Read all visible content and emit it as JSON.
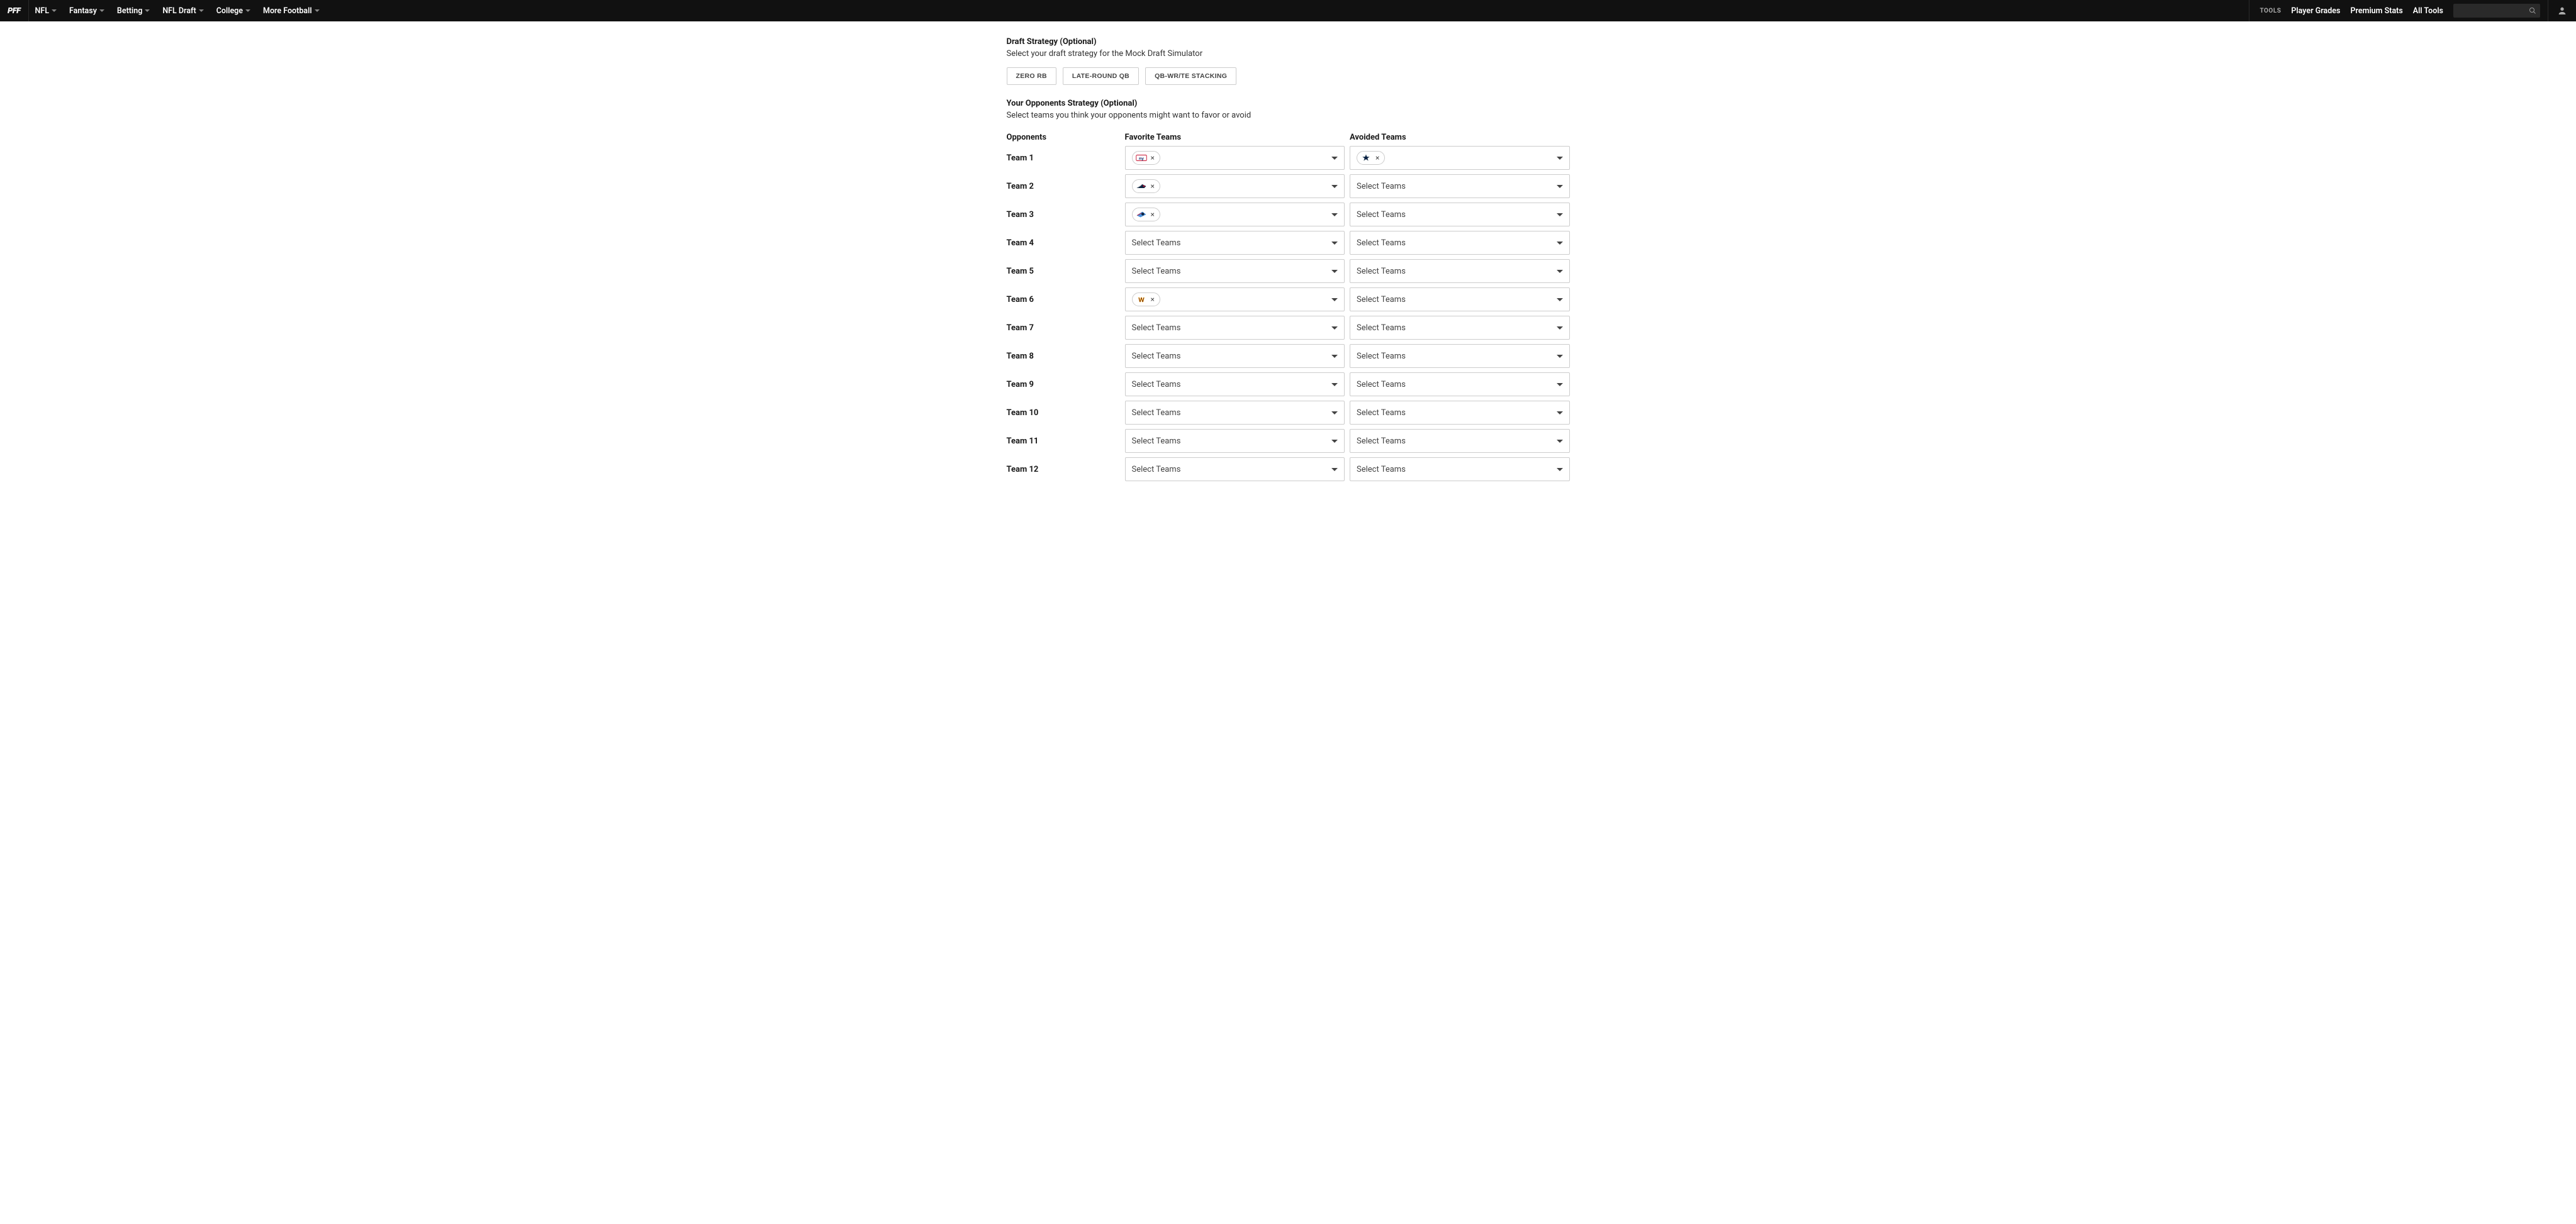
{
  "header": {
    "logo": "PFF",
    "nav": [
      "NFL",
      "Fantasy",
      "Betting",
      "NFL Draft",
      "College",
      "More Football"
    ],
    "tools_label": "TOOLS",
    "right_nav": [
      "Player Grades",
      "Premium Stats",
      "All Tools"
    ]
  },
  "draft_strategy": {
    "title": "Draft Strategy (Optional)",
    "subtitle": "Select your draft strategy for the Mock Draft Simulator",
    "options": [
      "ZERO RB",
      "LATE-ROUND QB",
      "QB-WR/TE STACKING"
    ]
  },
  "opponents_strategy": {
    "title": "Your Opponents Strategy (Optional)",
    "subtitle": "Select teams you think your opponents might want to favor or avoid"
  },
  "columns": {
    "opponents": "Opponents",
    "favorite": "Favorite Teams",
    "avoided": "Avoided Teams"
  },
  "select_placeholder": "Select Teams",
  "rows": [
    {
      "label": "Team 1",
      "favorite": [
        {
          "team": "NYG",
          "icon": "nyg"
        }
      ],
      "avoided": [
        {
          "team": "DAL",
          "icon": "dal"
        }
      ]
    },
    {
      "label": "Team 2",
      "favorite": [
        {
          "team": "NE",
          "icon": "ne"
        }
      ],
      "avoided": []
    },
    {
      "label": "Team 3",
      "favorite": [
        {
          "team": "TEN",
          "icon": "ten"
        }
      ],
      "avoided": []
    },
    {
      "label": "Team 4",
      "favorite": [],
      "avoided": []
    },
    {
      "label": "Team 5",
      "favorite": [],
      "avoided": []
    },
    {
      "label": "Team 6",
      "favorite": [
        {
          "team": "WAS",
          "icon": "was"
        }
      ],
      "avoided": []
    },
    {
      "label": "Team 7",
      "favorite": [],
      "avoided": []
    },
    {
      "label": "Team 8",
      "favorite": [],
      "avoided": []
    },
    {
      "label": "Team 9",
      "favorite": [],
      "avoided": []
    },
    {
      "label": "Team 10",
      "favorite": [],
      "avoided": []
    },
    {
      "label": "Team 11",
      "favorite": [],
      "avoided": []
    },
    {
      "label": "Team 12",
      "favorite": [],
      "avoided": []
    }
  ]
}
